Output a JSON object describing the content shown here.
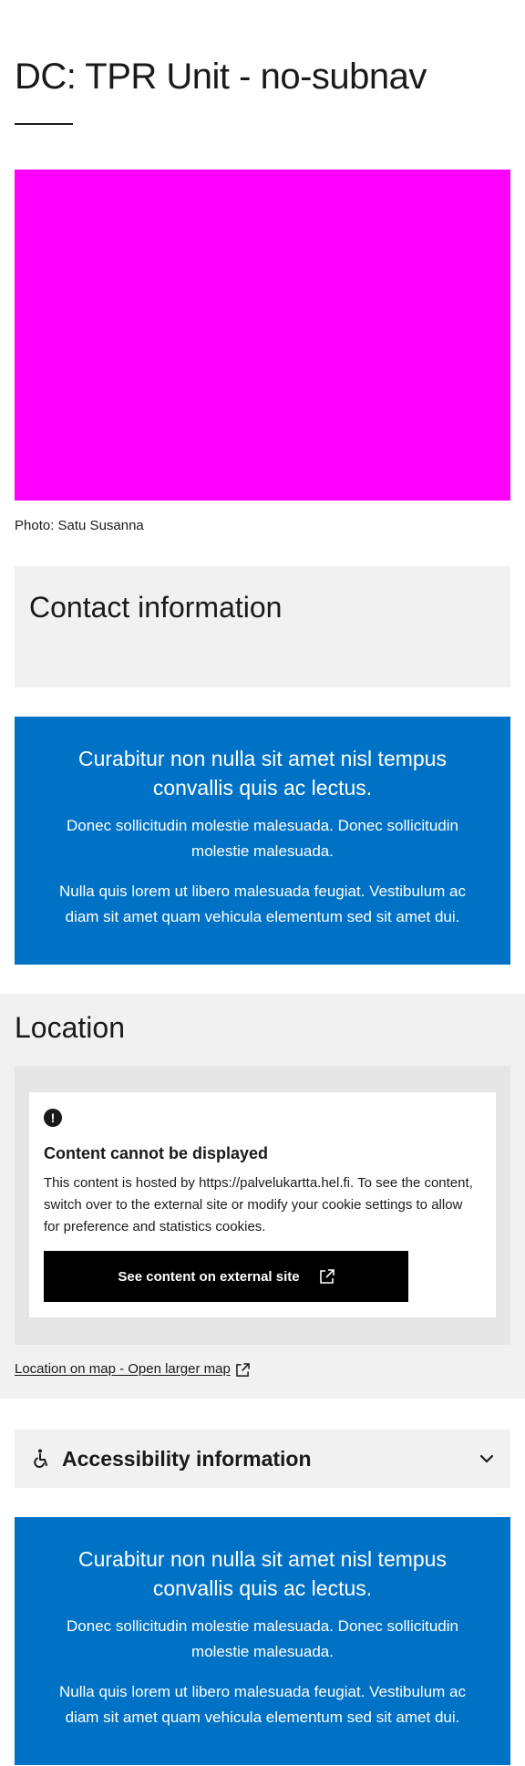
{
  "page": {
    "title": "DC: TPR Unit - no-subnav",
    "photo_credit": "Photo: Satu Susanna"
  },
  "colors": {
    "accent_blue": "#0072c6",
    "hero_placeholder": "#ff00ff",
    "surface_gray": "#f1f1f1"
  },
  "contact": {
    "heading": "Contact information"
  },
  "promo_top": {
    "heading": "Curabitur non nulla sit amet nisl tempus convallis quis ac lectus.",
    "paragraph_1": "Donec sollicitudin molestie malesuada. Donec sollicitudin molestie malesuada.",
    "paragraph_2": "Nulla quis lorem ut libero malesuada feugiat. Vestibulum ac diam sit amet quam vehicula elementum sed sit amet dui."
  },
  "location": {
    "heading": "Location",
    "embed": {
      "icon": "alert-circle-icon",
      "heading": "Content cannot be displayed",
      "text": "This content is hosted by https://palvelukartta.hel.fi. To see the content, switch over to the external site or modify your cookie settings to allow for preference and statistics cookies.",
      "button_label": "See content on external site",
      "button_icon": "external-link-icon"
    },
    "map_link": "Location on map - Open larger map"
  },
  "accessibility": {
    "label": "Accessibility information",
    "icon": "wheelchair-icon",
    "toggle_icon": "chevron-down-icon"
  },
  "promo_bottom": {
    "heading": "Curabitur non nulla sit amet nisl tempus convallis quis ac lectus.",
    "paragraph_1": "Donec sollicitudin molestie malesuada. Donec sollicitudin molestie malesuada.",
    "paragraph_2": "Nulla quis lorem ut libero malesuada feugiat. Vestibulum ac diam sit amet quam vehicula elementum sed sit amet dui."
  }
}
